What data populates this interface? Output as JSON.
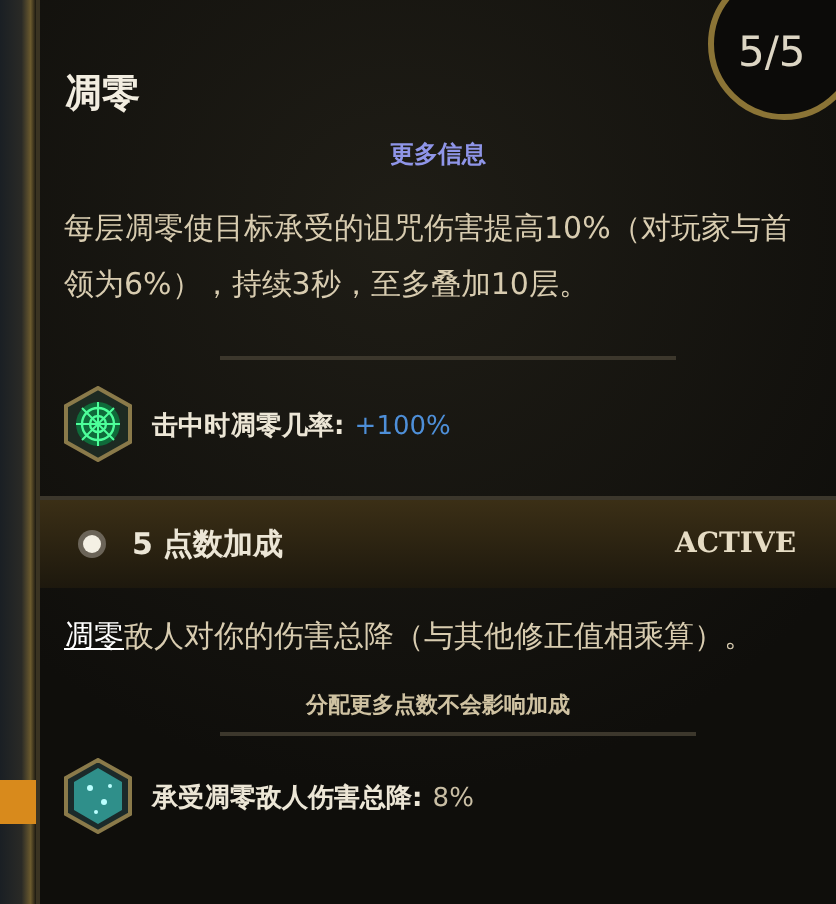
{
  "tooltip": {
    "title": "凋零",
    "rank": "5/5",
    "more_info": "更多信息",
    "description": "每层凋零使目标承受的诅咒伤害提高10%（对玩家与首领为6%），持续3秒，至多叠加10层。",
    "stat": {
      "label": "击中时凋零几率:",
      "value": "+100%",
      "highlight": true,
      "kind": "web"
    },
    "bonus": {
      "title": "5 点数加成",
      "status": "ACTIVE",
      "active": true,
      "keyword": "凋零",
      "description": "敌人对你的伤害总降（与其他修正值相乘算）。",
      "note": "分配更多点数不会影响加成",
      "stat": {
        "label": "承受凋零敌人伤害总降:",
        "value": "8%",
        "highlight": false,
        "kind": "crystal"
      }
    }
  }
}
